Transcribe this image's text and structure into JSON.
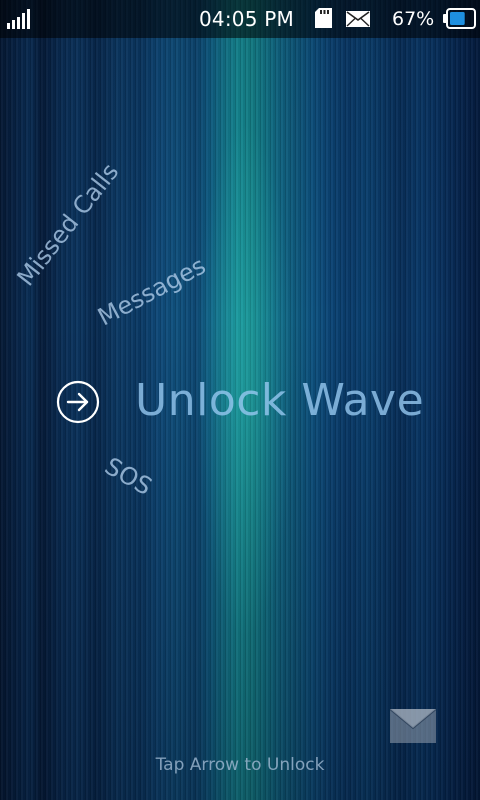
{
  "status_bar": {
    "time": "04:05 PM",
    "battery_percent": "67%",
    "battery_level": 0.67,
    "icons": [
      "signal-icon",
      "sd-card-icon",
      "mail-icon",
      "battery-icon"
    ]
  },
  "lock_screen": {
    "options": {
      "missed_calls": "Missed Calls",
      "messages": "Messages",
      "sos": "SOS"
    },
    "title": "Unlock Wave",
    "arrow_icon": "arrow-right-circle-icon",
    "hint": "Tap Arrow to Unlock",
    "notification_icon": "envelope-icon"
  },
  "colors": {
    "accent_text": "#96c8f0",
    "battery_fill": "#1e8fe0",
    "status_bar_bg": "#000000"
  }
}
